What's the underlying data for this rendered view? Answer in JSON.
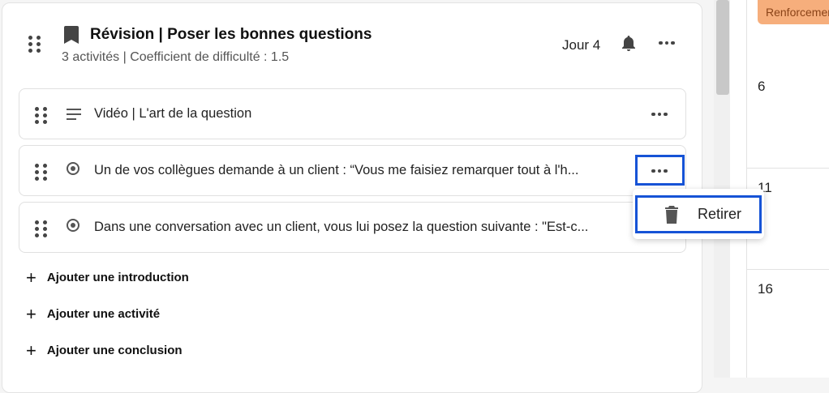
{
  "module": {
    "title": "Révision | Poser les bonnes questions",
    "subtitle": "3 activités | Coefficient de difficulté : 1.5",
    "day": "Jour 4"
  },
  "activities": [
    {
      "type": "video",
      "label": "Vidéo | L'art de la question"
    },
    {
      "type": "question",
      "label": "Un de vos collègues demande à un client : “Vous me faisiez remarquer tout à l'h..."
    },
    {
      "type": "question",
      "label": "Dans une conversation avec un client, vous lui posez la question suivante : \"Est-c..."
    }
  ],
  "context_menu": {
    "items": [
      {
        "label": "Retirer",
        "icon": "trash-icon"
      }
    ]
  },
  "add_links": {
    "introduction": "Ajouter une introduction",
    "activity": "Ajouter une activité",
    "conclusion": "Ajouter une conclusion"
  },
  "calendar": {
    "badge": "Renforcement",
    "days": [
      "6",
      "11",
      "16"
    ]
  },
  "colors": {
    "focus": "#1653d6",
    "badge_bg": "#f6ae7c",
    "badge_text": "#8a4318"
  }
}
